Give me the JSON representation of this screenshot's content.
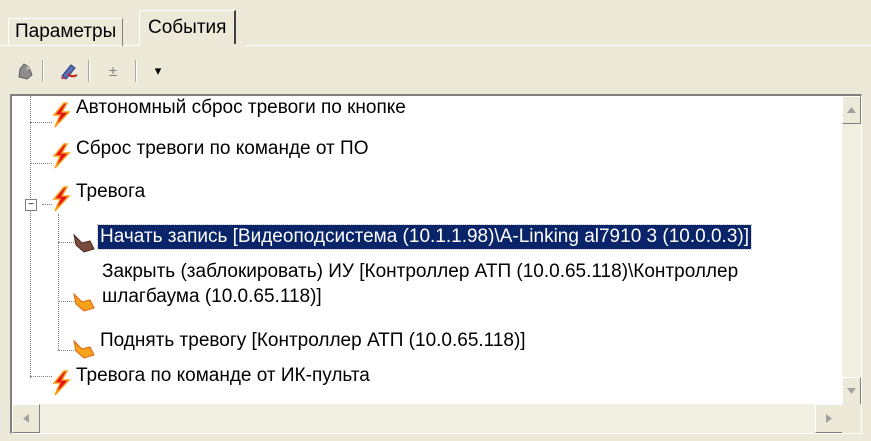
{
  "tabs": [
    {
      "label": "Параметры",
      "active": false
    },
    {
      "label": "События",
      "active": true
    }
  ],
  "toolbar": {
    "buttons": [
      "add-icon",
      "edit-icon",
      "expand-collapse-icon",
      "dropdown-arrow-icon"
    ],
    "expand_label": "±",
    "dropdown_label": "▾"
  },
  "tree": {
    "nodes": [
      {
        "label": "Автономный сброс тревоги по кнопке",
        "icon": "lightning-icon",
        "level": 0
      },
      {
        "label": "Сброс тревоги по команде от ПО",
        "icon": "lightning-icon",
        "level": 0
      },
      {
        "label": "Тревога",
        "icon": "lightning-icon",
        "level": 0,
        "expanded": true,
        "expander": "−"
      },
      {
        "label": "Начать запись [Видеоподсистема (10.1.1.98)\\A-Linking al7910 3 (10.0.0.3)]",
        "icon": "action-hand-icon",
        "level": 1,
        "selected": true
      },
      {
        "label_line1": "Закрыть (заблокировать) ИУ [Контроллер АТП (10.0.65.118)\\Контроллер",
        "label_line2": "шлагбаума (10.0.65.118)]",
        "icon": "action-hand-icon",
        "level": 1
      },
      {
        "label": "Поднять тревогу [Контроллер АТП (10.0.65.118)]",
        "icon": "action-hand-icon",
        "level": 1
      },
      {
        "label": "Тревога по команде от ИК-пульта",
        "icon": "lightning-icon",
        "level": 0
      }
    ]
  },
  "colors": {
    "selection_bg": "#0a246a",
    "lightning_red": "#e8101a",
    "lightning_orange": "#f7a21b",
    "panel_bg": "#ece9d8"
  }
}
